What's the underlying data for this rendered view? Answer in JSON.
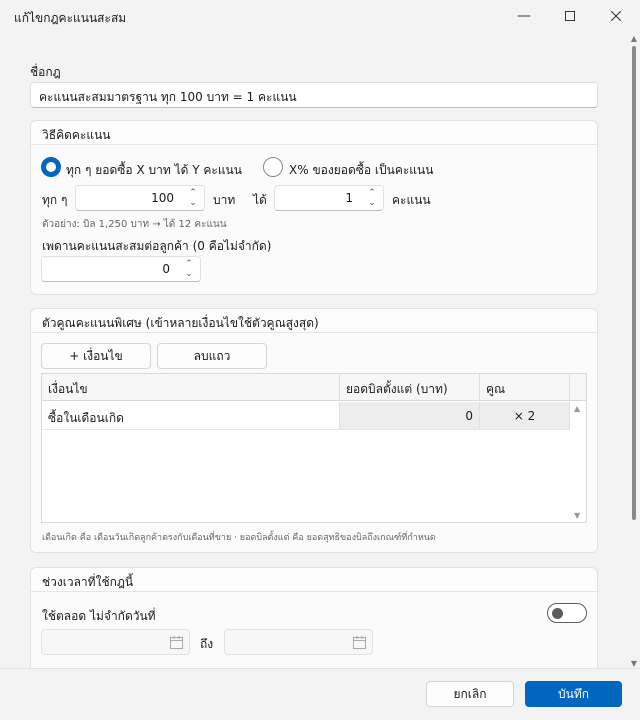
{
  "window": {
    "title": "แก้ไขกฎคะแนนสะสม"
  },
  "rule_name": {
    "label": "ชื่อกฎ",
    "value": "คะแนนสะสมมาตรฐาน ทุก 100 บาท = 1 คะแนน"
  },
  "calc": {
    "heading": "วิธีคิดคะแนน",
    "option_fixed": "ทุก ๆ ยอดซื้อ X บาท ได้ Y คะแนน",
    "option_percent": "X% ของยอดซื้อ เป็นคะแนน",
    "selected": "option_fixed",
    "every_label": "ทุก ๆ",
    "amount_value": "100",
    "baht_label": "บาท",
    "get_label": "ได้",
    "points_value": "1",
    "points_label": "คะแนน",
    "example": "ตัวอย่าง: บิล 1,250 บาท → ได้ 12 คะแนน",
    "cap_label": "เพดานคะแนนสะสมต่อลูกค้า (0 คือไม่จำกัด)",
    "cap_value": "0"
  },
  "multiplier": {
    "heading": "ตัวคูณคะแนนพิเศษ (เข้าหลายเงื่อนไขใช้ตัวคูณสูงสุด)",
    "add_button": "+ เงื่อนไข",
    "delete_button": "ลบแถว",
    "columns": [
      "เงื่อนไข",
      "ยอดบิลตั้งแต่ (บาท)",
      "คูณ"
    ],
    "rows": [
      {
        "condition": "ซื้อในเดือนเกิด",
        "min_bill": "0",
        "factor": "× 2"
      }
    ],
    "note": "เดือนเกิด คือ เดือนวันเกิดลูกค้าตรงกับเดือนที่ขาย · ยอดบิลตั้งแต่ คือ ยอดสุทธิของบิลถึงเกณฑ์ที่กำหนด"
  },
  "period": {
    "heading": "ช่วงเวลาที่ใช้กฎนี้",
    "always_label": "ใช้ตลอด ไม่จำกัดวันที่",
    "toggle_on": false,
    "to_label": "ถึง"
  },
  "footer": {
    "cancel": "ยกเลิก",
    "save": "บันทึก"
  }
}
